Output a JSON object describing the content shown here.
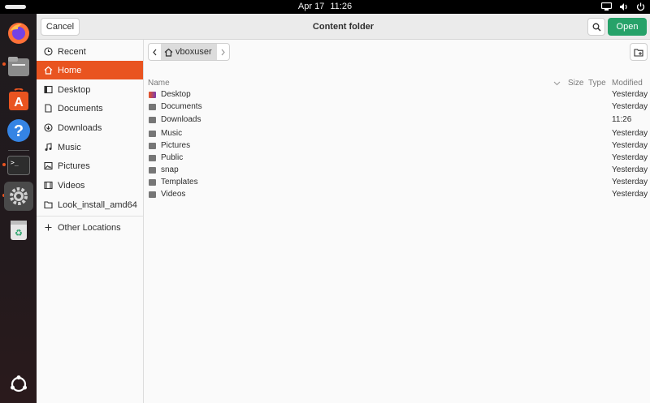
{
  "topbar": {
    "date": "Apr 17",
    "time": "11:26"
  },
  "dock": {
    "items": [
      {
        "name": "firefox-icon"
      },
      {
        "name": "files-icon"
      },
      {
        "name": "app-center-icon"
      },
      {
        "name": "help-icon"
      },
      {
        "name": "terminal-icon"
      },
      {
        "name": "settings-icon"
      },
      {
        "name": "trash-icon"
      }
    ]
  },
  "dialog": {
    "title": "Content folder",
    "cancel_label": "Cancel",
    "open_label": "Open",
    "accent_color": "#e95420",
    "open_color": "#26a269"
  },
  "sidebar": {
    "items": [
      {
        "label": "Recent",
        "icon": "clock-icon"
      },
      {
        "label": "Home",
        "icon": "home-icon"
      },
      {
        "label": "Desktop",
        "icon": "desktop-icon"
      },
      {
        "label": "Documents",
        "icon": "document-icon"
      },
      {
        "label": "Downloads",
        "icon": "download-icon"
      },
      {
        "label": "Music",
        "icon": "music-icon"
      },
      {
        "label": "Pictures",
        "icon": "picture-icon"
      },
      {
        "label": "Videos",
        "icon": "video-icon"
      },
      {
        "label": "Look_install_amd64",
        "icon": "folder-icon"
      }
    ],
    "other_locations": "Other Locations"
  },
  "pathbar": {
    "current": "vboxuser"
  },
  "columns": {
    "name": "Name",
    "size": "Size",
    "type": "Type",
    "modified": "Modified"
  },
  "files": [
    {
      "name": "Desktop",
      "modified": "Yesterday"
    },
    {
      "name": "Documents",
      "modified": "Yesterday"
    },
    {
      "name": "Downloads",
      "modified": "11:26"
    },
    {
      "name": "Music",
      "modified": "Yesterday"
    },
    {
      "name": "Pictures",
      "modified": "Yesterday"
    },
    {
      "name": "Public",
      "modified": "Yesterday"
    },
    {
      "name": "snap",
      "modified": "Yesterday"
    },
    {
      "name": "Templates",
      "modified": "Yesterday"
    },
    {
      "name": "Videos",
      "modified": "Yesterday"
    }
  ]
}
